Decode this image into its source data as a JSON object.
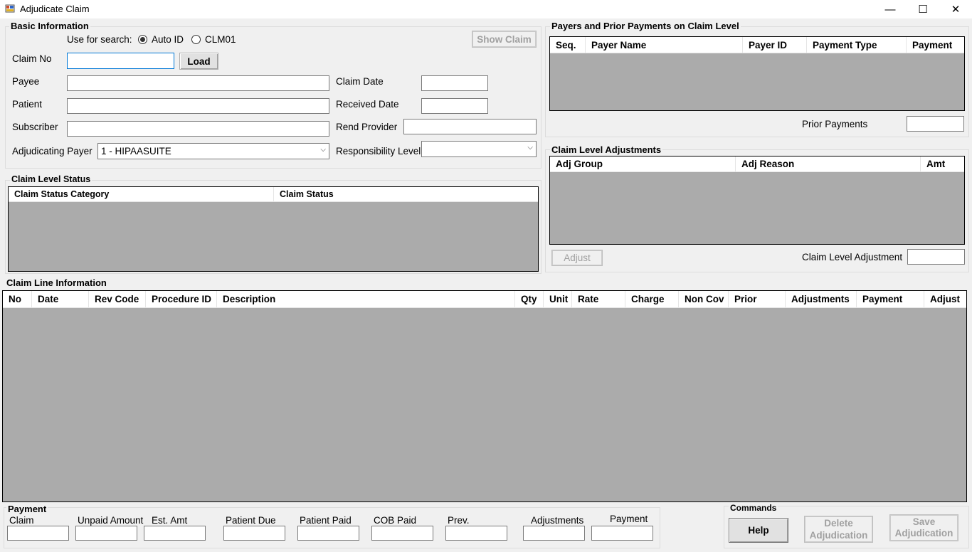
{
  "window": {
    "title": "Adjudicate Claim",
    "minimize": "—",
    "maximize": "☐",
    "close": "✕"
  },
  "basic": {
    "title": "Basic Information",
    "use_for_search": "Use for search:",
    "radio_auto": "Auto ID",
    "radio_clm": "CLM01",
    "show_claim": "Show Claim",
    "claim_no": "Claim No",
    "claim_no_value": "",
    "load": "Load",
    "payee": "Payee",
    "patient": "Patient",
    "subscriber": "Subscriber",
    "adj_payer": "Adjudicating Payer",
    "adj_payer_value": "1 - HIPAASUITE",
    "claim_date": "Claim Date",
    "received_date": "Received Date",
    "rend_provider": "Rend Provider",
    "resp_level": "Responsibility Level",
    "resp_level_value": ""
  },
  "status": {
    "title": "Claim Level Status",
    "columns": [
      "Claim Status Category",
      "Claim Status"
    ]
  },
  "payers": {
    "title": "Payers and Prior Payments on Claim Level",
    "columns": [
      "Seq.",
      "Payer Name",
      "Payer ID",
      "Payment Type",
      "Payment"
    ],
    "prior_payments": "Prior Payments"
  },
  "adjustments": {
    "title": "Claim Level Adjustments",
    "columns": [
      "Adj Group",
      "Adj Reason",
      "Amt"
    ],
    "adjust": "Adjust",
    "claim_level_adjustment": "Claim Level Adjustment"
  },
  "lines": {
    "title": "Claim Line Information",
    "columns": [
      "No",
      "Date",
      "Rev Code",
      "Procedure ID",
      "Description",
      "Qty",
      "Unit",
      "Rate",
      "Charge",
      "Non Cov",
      "Prior",
      "Adjustments",
      "Payment",
      "Adjust"
    ]
  },
  "payment": {
    "title": "Payment",
    "fields": [
      "Claim",
      "Unpaid Amount",
      "Est. Amt",
      "Patient Due",
      "Patient Paid",
      "COB Paid",
      "Prev.",
      "Adjustments",
      "Payment"
    ]
  },
  "commands": {
    "title": "Commands",
    "help": "Help",
    "delete_1": "Delete",
    "delete_2": "Adjudication",
    "save_1": "Save",
    "save_2": "Adjudication"
  }
}
